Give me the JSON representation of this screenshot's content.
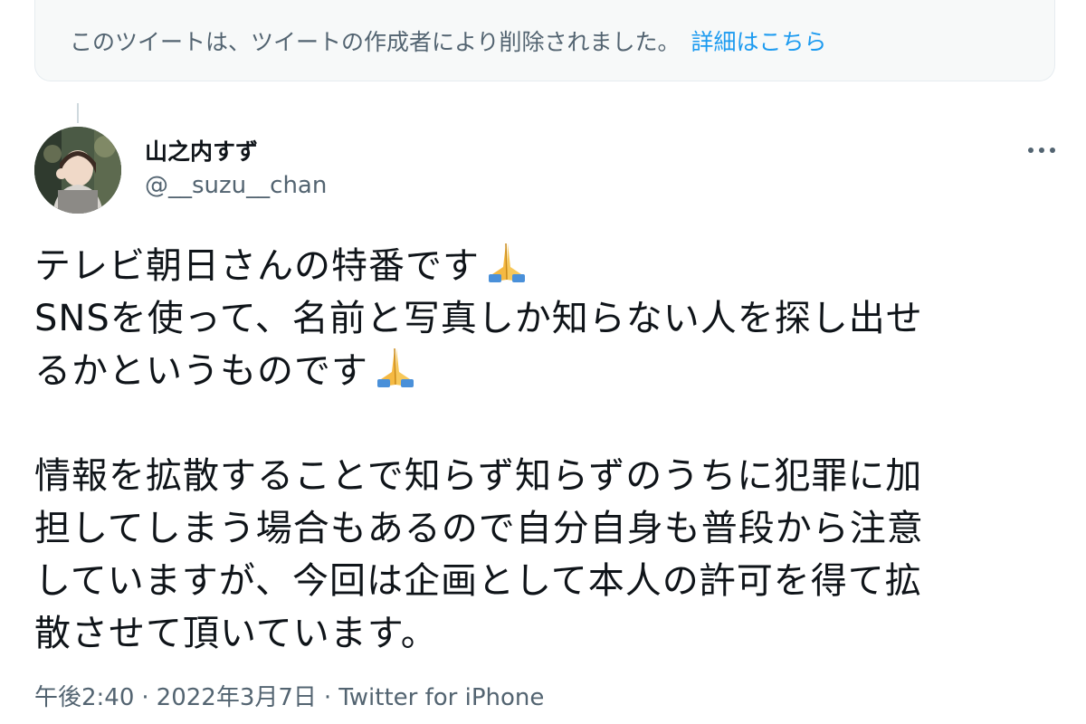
{
  "notice": {
    "text": "このツイートは、ツイートの作成者により削除されました。",
    "link_label": "詳細はこちら"
  },
  "author": {
    "display_name": "山之内すず",
    "handle": "@__suzu__chan",
    "avatar_icon": "profile-photo"
  },
  "more_icon": "more-dots-icon",
  "tweet": {
    "paragraph1": [
      "テレビ朝日さんの特番です",
      "SNSを使って、名前と写真しか知らない人を探し出せ",
      "るかというものです"
    ],
    "paragraph2": [
      "情報を拡散することで知らず知らずのうちに犯罪に加",
      "担してしまう場合もあるので自分自身も普段から注意",
      "していますが、今回は企画として本人の許可を得て拡",
      "散させて頂いています。"
    ],
    "emoji": "folded-hands-emoji"
  },
  "meta": {
    "time": "午後2:40",
    "date": "2022年3月7日",
    "separator": "·",
    "source": "Twitter for iPhone"
  },
  "colors": {
    "link": "#1d9bf0",
    "secondary_text": "#536471",
    "primary_text": "#0f1419",
    "notice_bg": "#f7f9f9"
  }
}
